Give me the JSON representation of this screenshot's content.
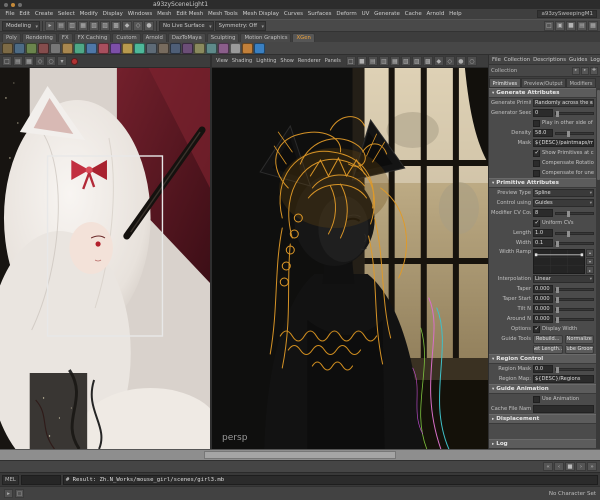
{
  "window": {
    "title": "a93zySceneLight1",
    "workspace": "a93zySweepingM1"
  },
  "menubar": {
    "items": [
      "File",
      "Edit",
      "Create",
      "Select",
      "Modify",
      "Display",
      "Windows",
      "Mesh",
      "Edit Mesh",
      "Mesh Tools",
      "Mesh Display",
      "Curves",
      "Surfaces",
      "Deform",
      "UV",
      "Generate",
      "Cache",
      "Arnold",
      "Help"
    ]
  },
  "statusline": {
    "mode": "Modeling",
    "live_surface": "No Live Surface",
    "symmetry": "Symmetry: Off",
    "left_icons": [
      "▸",
      "▤",
      "▥",
      "▦",
      "▧",
      "▨",
      "▩",
      "◆",
      "◇",
      "●"
    ],
    "right_icons": [
      "□",
      "▣",
      "■",
      "▤",
      "▦"
    ]
  },
  "shelf": {
    "tabs": [
      {
        "label": "Poly"
      },
      {
        "label": "Rendering"
      },
      {
        "label": "FX"
      },
      {
        "label": "FX Caching"
      },
      {
        "label": "Custom"
      },
      {
        "label": "Arnold"
      },
      {
        "label": "DazToMaya"
      },
      {
        "label": "Sculpting"
      },
      {
        "label": "Motion Graphics"
      },
      {
        "label": "XGen",
        "active": true
      }
    ],
    "icon_colors": [
      "#7d6a45",
      "#4d6b85",
      "#6b854d",
      "#854d4d",
      "#777777",
      "#a8874f",
      "#4fa887",
      "#4f78a8",
      "#a84f5e",
      "#7d4fa8",
      "#b89a4e",
      "#4eb89a",
      "#5e6b77",
      "#776b5e",
      "#4e5e77",
      "#6b4e77",
      "#8a8a5e",
      "#5e8a8a",
      "#8a5e8a",
      "#9a9a9a",
      "#c2803a",
      "#3a80c2"
    ]
  },
  "ref_panel": {
    "icons": [
      "□",
      "▤",
      "▦",
      "◇",
      "○",
      "▾"
    ]
  },
  "viewport": {
    "menus": [
      "View",
      "Shading",
      "Lighting",
      "Show",
      "Renderer",
      "Panels"
    ],
    "icons": [
      "□",
      "■",
      "▤",
      "▥",
      "▦",
      "▧",
      "▨",
      "▩",
      "◆",
      "◇",
      "●",
      "○"
    ],
    "camera_label": "persp"
  },
  "xgen": {
    "menus": [
      "File",
      "Collection",
      "Descriptions",
      "Guides",
      "Log"
    ],
    "collection_label": "Collection",
    "collection_icons": [
      "▸",
      "▸",
      "✚"
    ],
    "tabs": [
      {
        "label": "Primitives",
        "active": true
      },
      {
        "label": "Preview/Output"
      },
      {
        "label": "Modifiers"
      }
    ],
    "generate": {
      "title": "Generate Attributes",
      "gp_label": "Generate Primitives:",
      "gp_value": "Randomly across the surface",
      "seed_label": "Generator Seed",
      "seed_value": "0",
      "flip_label": "Play in other side of surface",
      "flip_checked": false,
      "density_label": "Density",
      "density_value": "58.0",
      "mask_label": "Mask",
      "mask_value": "${DESC}/paintmaps/mask",
      "cb_show_label": "Show Primitives at creation",
      "cb_show_checked": true,
      "cb_rot_label": "Compensate Rotation",
      "cb_rot_checked": false,
      "cb_uneven_label": "Compensate for uneven UVs",
      "cb_uneven_checked": false
    },
    "primitive": {
      "title": "Primitive Attributes",
      "preview_label": "Preview Type",
      "preview_value": "Spline",
      "control_label": "Control using",
      "control_value": "Guides",
      "cv_label": "Modifier CV Count",
      "cv_value": "8",
      "uniform_label": "Uniform CVs",
      "uniform_checked": true,
      "length_label": "Length",
      "length_value": "1.0",
      "width_label": "Width",
      "width_value": "0.1",
      "ramp_label": "Width Ramp",
      "interp_label": "Interpolation",
      "interp_value": "Linear",
      "taper_label": "Taper",
      "taper_value": "0.000",
      "taper_start_label": "Taper Start",
      "taper_start_value": "0.000",
      "tilt_label": "Tilt N",
      "tilt_value": "0.000",
      "around_label": "Around N",
      "around_value": "0.000",
      "options_label": "Options",
      "display_width_label": "Display Width",
      "display_width_checked": true,
      "guide_tools_label": "Guide Tools",
      "buttons": [
        "Rebuild...",
        "Normalize",
        "Set Length...",
        "Tube Groom"
      ]
    },
    "region": {
      "title": "Region Control",
      "mask_label": "Region Mask",
      "mask_value": "0.0",
      "map_label": "Region Map:",
      "map_value": "${DESC}/Regions"
    },
    "guide_animation": {
      "title": "Guide Animation",
      "use_label": "Use Animation",
      "use_checked": false,
      "cache_label": "Cache File Name"
    },
    "displacement": {
      "title": "Displacement"
    },
    "log_title": "Log"
  },
  "playback": {
    "buttons": [
      "«",
      "‹",
      "■",
      "›",
      "»"
    ]
  },
  "command_line": {
    "toggle": "MEL",
    "result": "# Result: Zh.N_Works/mouse_girl/scenes/girl3.mb"
  },
  "help_line": {
    "status": "No Character Set",
    "icons": [
      "▸",
      "□"
    ]
  },
  "colors": {
    "guide_orange": "#e09a28",
    "selection_blue": "#5285a6",
    "shelf_active": "#f0a33c"
  }
}
